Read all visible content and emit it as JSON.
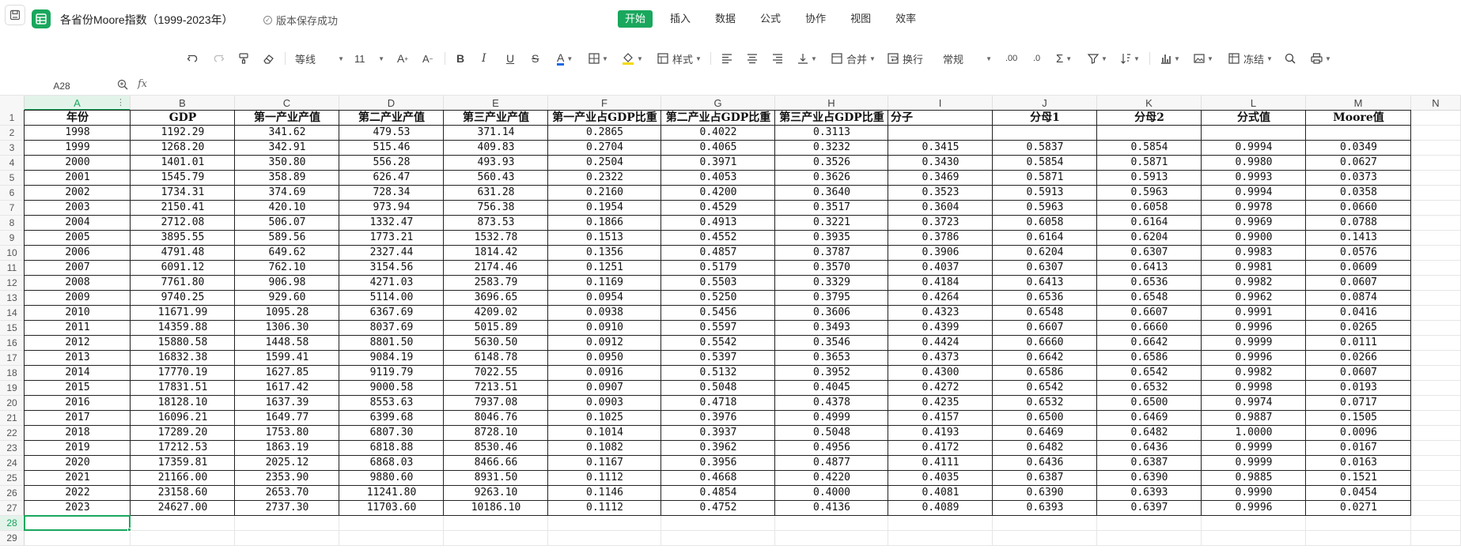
{
  "window": {
    "title": "各省份Moore指数（1999-2023年）",
    "save_status": "版本保存成功"
  },
  "menu": {
    "items": [
      "开始",
      "插入",
      "数据",
      "公式",
      "协作",
      "视图",
      "效率"
    ],
    "active": "开始"
  },
  "toolbar": {
    "font_family": "等线",
    "font_size": "11",
    "style_label": "样式",
    "merge_label": "合并",
    "wrap_label": "换行",
    "number_format": "常规",
    "freeze_label": "冻结",
    "accent_color": "#19a75d",
    "font_color": "#1d6ae5",
    "fill_color": "#f5d90a"
  },
  "formula_bar": {
    "cell_ref": "A28",
    "fx_label": "fx",
    "value": ""
  },
  "sheet": {
    "columns": [
      "A",
      "B",
      "C",
      "D",
      "E",
      "F",
      "G",
      "H",
      "I",
      "J",
      "K",
      "L",
      "M",
      "N"
    ],
    "selected_column": "A",
    "selected_row": 28,
    "row_numbers": [
      "1",
      "2",
      "3",
      "4",
      "5",
      "6",
      "7",
      "8",
      "9",
      "10",
      "11",
      "12",
      "13",
      "14",
      "15",
      "16",
      "17",
      "18",
      "19",
      "20",
      "21",
      "22",
      "23",
      "24",
      "25",
      "26",
      "27",
      "28",
      "29"
    ],
    "headers": [
      "年份",
      "GDP",
      "第一产业产值",
      "第二产业产值",
      "第三产业产值",
      "第一产业占GDP比重",
      "第二产业占GDP比重",
      "第三产业占GDP比重",
      "分子",
      "分母1",
      "分母2",
      "分式值",
      "Moore值"
    ],
    "rows": [
      [
        "1998",
        "1192.29",
        "341.62",
        "479.53",
        "371.14",
        "0.2865",
        "0.4022",
        "0.3113",
        "",
        "",
        "",
        "",
        ""
      ],
      [
        "1999",
        "1268.20",
        "342.91",
        "515.46",
        "409.83",
        "0.2704",
        "0.4065",
        "0.3232",
        "0.3415",
        "0.5837",
        "0.5854",
        "0.9994",
        "0.0349"
      ],
      [
        "2000",
        "1401.01",
        "350.80",
        "556.28",
        "493.93",
        "0.2504",
        "0.3971",
        "0.3526",
        "0.3430",
        "0.5854",
        "0.5871",
        "0.9980",
        "0.0627"
      ],
      [
        "2001",
        "1545.79",
        "358.89",
        "626.47",
        "560.43",
        "0.2322",
        "0.4053",
        "0.3626",
        "0.3469",
        "0.5871",
        "0.5913",
        "0.9993",
        "0.0373"
      ],
      [
        "2002",
        "1734.31",
        "374.69",
        "728.34",
        "631.28",
        "0.2160",
        "0.4200",
        "0.3640",
        "0.3523",
        "0.5913",
        "0.5963",
        "0.9994",
        "0.0358"
      ],
      [
        "2003",
        "2150.41",
        "420.10",
        "973.94",
        "756.38",
        "0.1954",
        "0.4529",
        "0.3517",
        "0.3604",
        "0.5963",
        "0.6058",
        "0.9978",
        "0.0660"
      ],
      [
        "2004",
        "2712.08",
        "506.07",
        "1332.47",
        "873.53",
        "0.1866",
        "0.4913",
        "0.3221",
        "0.3723",
        "0.6058",
        "0.6164",
        "0.9969",
        "0.0788"
      ],
      [
        "2005",
        "3895.55",
        "589.56",
        "1773.21",
        "1532.78",
        "0.1513",
        "0.4552",
        "0.3935",
        "0.3786",
        "0.6164",
        "0.6204",
        "0.9900",
        "0.1413"
      ],
      [
        "2006",
        "4791.48",
        "649.62",
        "2327.44",
        "1814.42",
        "0.1356",
        "0.4857",
        "0.3787",
        "0.3906",
        "0.6204",
        "0.6307",
        "0.9983",
        "0.0576"
      ],
      [
        "2007",
        "6091.12",
        "762.10",
        "3154.56",
        "2174.46",
        "0.1251",
        "0.5179",
        "0.3570",
        "0.4037",
        "0.6307",
        "0.6413",
        "0.9981",
        "0.0609"
      ],
      [
        "2008",
        "7761.80",
        "906.98",
        "4271.03",
        "2583.79",
        "0.1169",
        "0.5503",
        "0.3329",
        "0.4184",
        "0.6413",
        "0.6536",
        "0.9982",
        "0.0607"
      ],
      [
        "2009",
        "9740.25",
        "929.60",
        "5114.00",
        "3696.65",
        "0.0954",
        "0.5250",
        "0.3795",
        "0.4264",
        "0.6536",
        "0.6548",
        "0.9962",
        "0.0874"
      ],
      [
        "2010",
        "11671.99",
        "1095.28",
        "6367.69",
        "4209.02",
        "0.0938",
        "0.5456",
        "0.3606",
        "0.4323",
        "0.6548",
        "0.6607",
        "0.9991",
        "0.0416"
      ],
      [
        "2011",
        "14359.88",
        "1306.30",
        "8037.69",
        "5015.89",
        "0.0910",
        "0.5597",
        "0.3493",
        "0.4399",
        "0.6607",
        "0.6660",
        "0.9996",
        "0.0265"
      ],
      [
        "2012",
        "15880.58",
        "1448.58",
        "8801.50",
        "5630.50",
        "0.0912",
        "0.5542",
        "0.3546",
        "0.4424",
        "0.6660",
        "0.6642",
        "0.9999",
        "0.0111"
      ],
      [
        "2013",
        "16832.38",
        "1599.41",
        "9084.19",
        "6148.78",
        "0.0950",
        "0.5397",
        "0.3653",
        "0.4373",
        "0.6642",
        "0.6586",
        "0.9996",
        "0.0266"
      ],
      [
        "2014",
        "17770.19",
        "1627.85",
        "9119.79",
        "7022.55",
        "0.0916",
        "0.5132",
        "0.3952",
        "0.4300",
        "0.6586",
        "0.6542",
        "0.9982",
        "0.0607"
      ],
      [
        "2015",
        "17831.51",
        "1617.42",
        "9000.58",
        "7213.51",
        "0.0907",
        "0.5048",
        "0.4045",
        "0.4272",
        "0.6542",
        "0.6532",
        "0.9998",
        "0.0193"
      ],
      [
        "2016",
        "18128.10",
        "1637.39",
        "8553.63",
        "7937.08",
        "0.0903",
        "0.4718",
        "0.4378",
        "0.4235",
        "0.6532",
        "0.6500",
        "0.9974",
        "0.0717"
      ],
      [
        "2017",
        "16096.21",
        "1649.77",
        "6399.68",
        "8046.76",
        "0.1025",
        "0.3976",
        "0.4999",
        "0.4157",
        "0.6500",
        "0.6469",
        "0.9887",
        "0.1505"
      ],
      [
        "2018",
        "17289.20",
        "1753.80",
        "6807.30",
        "8728.10",
        "0.1014",
        "0.3937",
        "0.5048",
        "0.4193",
        "0.6469",
        "0.6482",
        "1.0000",
        "0.0096"
      ],
      [
        "2019",
        "17212.53",
        "1863.19",
        "6818.88",
        "8530.46",
        "0.1082",
        "0.3962",
        "0.4956",
        "0.4172",
        "0.6482",
        "0.6436",
        "0.9999",
        "0.0167"
      ],
      [
        "2020",
        "17359.81",
        "2025.12",
        "6868.03",
        "8466.66",
        "0.1167",
        "0.3956",
        "0.4877",
        "0.4111",
        "0.6436",
        "0.6387",
        "0.9999",
        "0.0163"
      ],
      [
        "2021",
        "21166.00",
        "2353.90",
        "9880.60",
        "8931.50",
        "0.1112",
        "0.4668",
        "0.4220",
        "0.4035",
        "0.6387",
        "0.6390",
        "0.9885",
        "0.1521"
      ],
      [
        "2022",
        "23158.60",
        "2653.70",
        "11241.80",
        "9263.10",
        "0.1146",
        "0.4854",
        "0.4000",
        "0.4081",
        "0.6390",
        "0.6393",
        "0.9990",
        "0.0454"
      ],
      [
        "2023",
        "24627.00",
        "2737.30",
        "11703.60",
        "10186.10",
        "0.1112",
        "0.4752",
        "0.4136",
        "0.4089",
        "0.6393",
        "0.6397",
        "0.9996",
        "0.0271"
      ]
    ]
  }
}
